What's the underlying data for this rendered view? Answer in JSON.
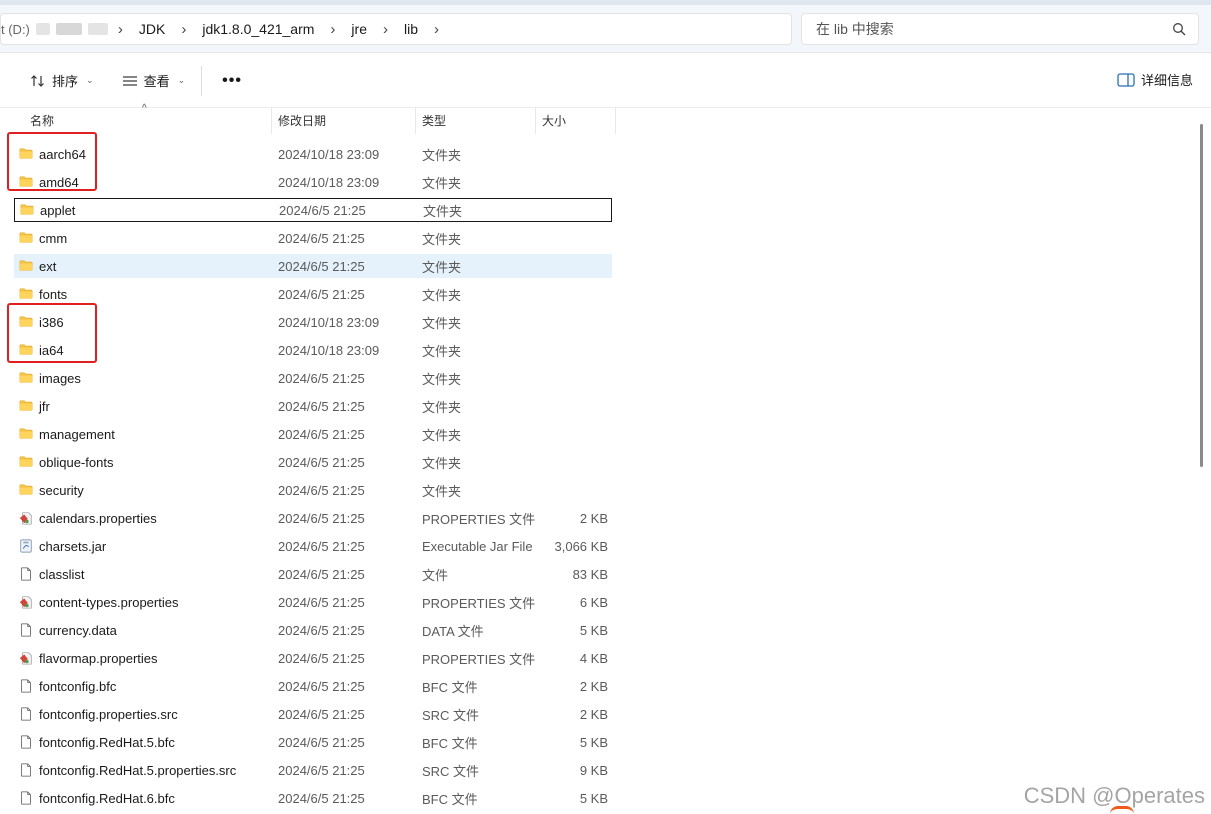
{
  "address": {
    "hidden_prefix": "t (D:)",
    "crumbs": [
      "JDK",
      "jdk1.8.0_421_arm",
      "jre",
      "lib"
    ],
    "separator": "›"
  },
  "search": {
    "placeholder": "在 lib 中搜索"
  },
  "toolbar": {
    "sort_label": "排序",
    "view_label": "查看",
    "more_label": "•••",
    "details_label": "详细信息"
  },
  "columns": {
    "name": "名称",
    "date": "修改日期",
    "type": "类型",
    "size": "大小"
  },
  "files": [
    {
      "name": "aarch64",
      "date": "2024/10/18 23:09",
      "type": "文件夹",
      "size": "",
      "icon": "folder-icon"
    },
    {
      "name": "amd64",
      "date": "2024/10/18 23:09",
      "type": "文件夹",
      "size": "",
      "icon": "folder-icon"
    },
    {
      "name": "applet",
      "date": "2024/6/5 21:25",
      "type": "文件夹",
      "size": "",
      "icon": "folder-icon",
      "state": "selected"
    },
    {
      "name": "cmm",
      "date": "2024/6/5 21:25",
      "type": "文件夹",
      "size": "",
      "icon": "folder-icon"
    },
    {
      "name": "ext",
      "date": "2024/6/5 21:25",
      "type": "文件夹",
      "size": "",
      "icon": "folder-icon",
      "state": "hover"
    },
    {
      "name": "fonts",
      "date": "2024/6/5 21:25",
      "type": "文件夹",
      "size": "",
      "icon": "folder-icon"
    },
    {
      "name": "i386",
      "date": "2024/10/18 23:09",
      "type": "文件夹",
      "size": "",
      "icon": "folder-icon"
    },
    {
      "name": "ia64",
      "date": "2024/10/18 23:09",
      "type": "文件夹",
      "size": "",
      "icon": "folder-icon"
    },
    {
      "name": "images",
      "date": "2024/6/5 21:25",
      "type": "文件夹",
      "size": "",
      "icon": "folder-icon"
    },
    {
      "name": "jfr",
      "date": "2024/6/5 21:25",
      "type": "文件夹",
      "size": "",
      "icon": "folder-icon"
    },
    {
      "name": "management",
      "date": "2024/6/5 21:25",
      "type": "文件夹",
      "size": "",
      "icon": "folder-icon"
    },
    {
      "name": "oblique-fonts",
      "date": "2024/6/5 21:25",
      "type": "文件夹",
      "size": "",
      "icon": "folder-icon"
    },
    {
      "name": "security",
      "date": "2024/6/5 21:25",
      "type": "文件夹",
      "size": "",
      "icon": "folder-icon"
    },
    {
      "name": "calendars.properties",
      "date": "2024/6/5 21:25",
      "type": "PROPERTIES 文件",
      "size": "2 KB",
      "icon": "properties-file-icon"
    },
    {
      "name": "charsets.jar",
      "date": "2024/6/5 21:25",
      "type": "Executable Jar File",
      "size": "3,066 KB",
      "icon": "jar-file-icon"
    },
    {
      "name": "classlist",
      "date": "2024/6/5 21:25",
      "type": "文件",
      "size": "83 KB",
      "icon": "file-icon"
    },
    {
      "name": "content-types.properties",
      "date": "2024/6/5 21:25",
      "type": "PROPERTIES 文件",
      "size": "6 KB",
      "icon": "properties-file-icon"
    },
    {
      "name": "currency.data",
      "date": "2024/6/5 21:25",
      "type": "DATA 文件",
      "size": "5 KB",
      "icon": "file-icon"
    },
    {
      "name": "flavormap.properties",
      "date": "2024/6/5 21:25",
      "type": "PROPERTIES 文件",
      "size": "4 KB",
      "icon": "properties-file-icon"
    },
    {
      "name": "fontconfig.bfc",
      "date": "2024/6/5 21:25",
      "type": "BFC 文件",
      "size": "2 KB",
      "icon": "file-icon"
    },
    {
      "name": "fontconfig.properties.src",
      "date": "2024/6/5 21:25",
      "type": "SRC 文件",
      "size": "2 KB",
      "icon": "file-icon"
    },
    {
      "name": "fontconfig.RedHat.5.bfc",
      "date": "2024/6/5 21:25",
      "type": "BFC 文件",
      "size": "5 KB",
      "icon": "file-icon"
    },
    {
      "name": "fontconfig.RedHat.5.properties.src",
      "date": "2024/6/5 21:25",
      "type": "SRC 文件",
      "size": "9 KB",
      "icon": "file-icon"
    },
    {
      "name": "fontconfig.RedHat.6.bfc",
      "date": "2024/6/5 21:25",
      "type": "BFC 文件",
      "size": "5 KB",
      "icon": "file-icon"
    }
  ],
  "colors": {
    "highlight": "#e02020",
    "folder": "#f5c242",
    "hover": "#e5f1fb"
  },
  "watermark": "CSDN @Operates"
}
